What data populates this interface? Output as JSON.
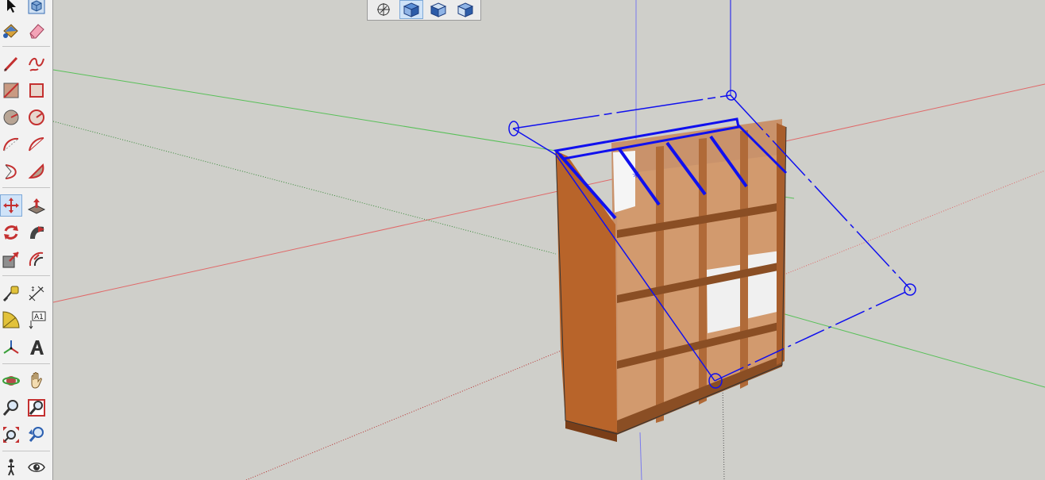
{
  "toolbar": {
    "tools": [
      {
        "id": "select",
        "icon": "arrow-select-icon"
      },
      {
        "id": "make-component",
        "icon": "component-cube-icon"
      },
      {
        "id": "paint-bucket",
        "icon": "paint-bucket-icon"
      },
      {
        "id": "eraser",
        "icon": "eraser-icon"
      },
      {
        "id": "line",
        "icon": "pencil-line-icon"
      },
      {
        "id": "freehand",
        "icon": "freehand-icon"
      },
      {
        "id": "rectangle",
        "icon": "rectangle-icon"
      },
      {
        "id": "rotated-rectangle",
        "icon": "rotated-rectangle-icon"
      },
      {
        "id": "circle",
        "icon": "circle-icon"
      },
      {
        "id": "polygon",
        "icon": "polygon-icon"
      },
      {
        "id": "arc",
        "icon": "arc-icon"
      },
      {
        "id": "2-point-arc",
        "icon": "two-point-arc-icon"
      },
      {
        "id": "3-point-arc",
        "icon": "three-point-arc-icon"
      },
      {
        "id": "pie",
        "icon": "pie-icon"
      },
      {
        "id": "move",
        "icon": "move-arrows-icon"
      },
      {
        "id": "push-pull",
        "icon": "push-pull-icon"
      },
      {
        "id": "rotate",
        "icon": "rotate-icon"
      },
      {
        "id": "follow-me",
        "icon": "follow-me-icon"
      },
      {
        "id": "scale",
        "icon": "scale-icon"
      },
      {
        "id": "offset",
        "icon": "offset-icon"
      },
      {
        "id": "tape-measure",
        "icon": "tape-measure-icon"
      },
      {
        "id": "dimension",
        "icon": "dimension-icon"
      },
      {
        "id": "protractor",
        "icon": "protractor-icon"
      },
      {
        "id": "text",
        "icon": "text-label-icon",
        "label": "A1"
      },
      {
        "id": "axes",
        "icon": "axes-icon"
      },
      {
        "id": "3d-text",
        "icon": "3d-text-icon"
      },
      {
        "id": "orbit",
        "icon": "orbit-icon"
      },
      {
        "id": "pan",
        "icon": "pan-hand-icon"
      },
      {
        "id": "zoom",
        "icon": "zoom-icon"
      },
      {
        "id": "zoom-window",
        "icon": "zoom-window-icon"
      },
      {
        "id": "zoom-extents",
        "icon": "zoom-extents-icon"
      },
      {
        "id": "previous-view",
        "icon": "previous-view-icon"
      },
      {
        "id": "walk",
        "icon": "walk-icon"
      },
      {
        "id": "look-around",
        "icon": "look-around-eye-icon"
      }
    ],
    "active_tool": "move"
  },
  "view_toolbar": {
    "buttons": [
      {
        "id": "iso",
        "icon": "iso-view-icon"
      },
      {
        "id": "top",
        "icon": "top-view-icon"
      },
      {
        "id": "front",
        "icon": "front-view-icon"
      },
      {
        "id": "right",
        "icon": "right-view-icon"
      }
    ],
    "active_view": "top"
  },
  "colors": {
    "background": "#cfcfca",
    "selection": "#1010ee",
    "wood": "#c06a2c",
    "red_axis": "#e06868",
    "green_axis": "#58c058"
  }
}
